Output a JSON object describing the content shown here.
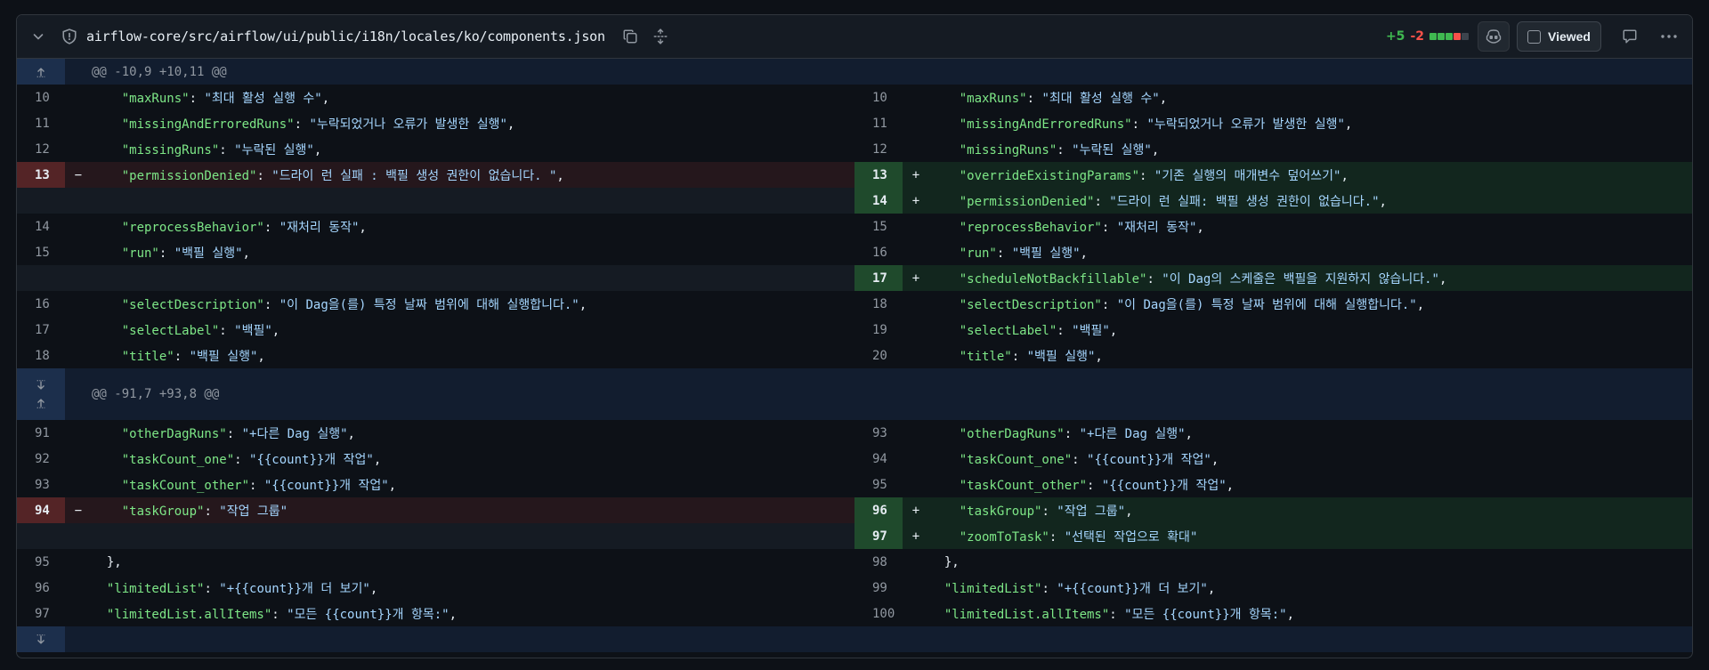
{
  "file": {
    "path": "airflow-core/src/airflow/ui/public/i18n/locales/ko/components.json",
    "additions": "+5",
    "deletions": "-2",
    "diffstat": [
      "add",
      "add",
      "add",
      "del",
      "neu"
    ],
    "viewed_label": "Viewed",
    "icons": {
      "collapse": "chevron-down-icon",
      "shield": "shield-icon",
      "copy": "copy-icon",
      "expand": "unfold-icon",
      "copilot": "copilot-icon",
      "comment": "comment-icon",
      "more": "kebab-icon"
    }
  },
  "hunks": [
    {
      "header": "@@ -10,9 +10,11 @@",
      "rows": [
        {
          "type": "ctx",
          "l": "10",
          "r": "10",
          "indent": "    ",
          "key": "\"maxRuns\"",
          "val": "\"최대 활성 실행 수\"",
          "tail": ","
        },
        {
          "type": "ctx",
          "l": "11",
          "r": "11",
          "indent": "    ",
          "key": "\"missingAndErroredRuns\"",
          "val": "\"누락되었거나 오류가 발생한 실행\"",
          "tail": ","
        },
        {
          "type": "ctx",
          "l": "12",
          "r": "12",
          "indent": "    ",
          "key": "\"missingRuns\"",
          "val": "\"누락된 실행\"",
          "tail": ","
        },
        {
          "type": "chg",
          "l": "13",
          "lkey": "\"permissionDenied\"",
          "lval": "\"드라이 런 실패 : 백필 생성 권한이 없습니다. \"",
          "ltail": ",",
          "r": "13",
          "rkey": "\"overrideExistingParams\"",
          "rval": "\"기존 실행의 매개변수 덮어쓰기\"",
          "rtail": ","
        },
        {
          "type": "add",
          "r": "14",
          "key": "\"permissionDenied\"",
          "val": "\"드라이 런 실패: 백필 생성 권한이 없습니다.\"",
          "tail": ","
        },
        {
          "type": "ctx",
          "l": "14",
          "r": "15",
          "indent": "    ",
          "key": "\"reprocessBehavior\"",
          "val": "\"재처리 동작\"",
          "tail": ","
        },
        {
          "type": "ctx",
          "l": "15",
          "r": "16",
          "indent": "    ",
          "key": "\"run\"",
          "val": "\"백필 실행\"",
          "tail": ","
        },
        {
          "type": "add",
          "r": "17",
          "key": "\"scheduleNotBackfillable\"",
          "val": "\"이 Dag의 스케줄은 백필을 지원하지 않습니다.\"",
          "tail": ","
        },
        {
          "type": "ctx",
          "l": "16",
          "r": "18",
          "indent": "    ",
          "key": "\"selectDescription\"",
          "val": "\"이 Dag을(를) 특정 날짜 범위에 대해 실행합니다.\"",
          "tail": ","
        },
        {
          "type": "ctx",
          "l": "17",
          "r": "19",
          "indent": "    ",
          "key": "\"selectLabel\"",
          "val": "\"백필\"",
          "tail": ","
        },
        {
          "type": "ctx",
          "l": "18",
          "r": "20",
          "indent": "    ",
          "key": "\"title\"",
          "val": "\"백필 실행\"",
          "tail": ","
        }
      ]
    },
    {
      "header": "@@ -91,7 +93,8 @@",
      "rows": [
        {
          "type": "ctx",
          "l": "91",
          "r": "93",
          "indent": "    ",
          "key": "\"otherDagRuns\"",
          "val": "\"+다른 Dag 실행\"",
          "tail": ","
        },
        {
          "type": "ctx",
          "l": "92",
          "r": "94",
          "indent": "    ",
          "key": "\"taskCount_one\"",
          "val": "\"{{count}}개 작업\"",
          "tail": ","
        },
        {
          "type": "ctx",
          "l": "93",
          "r": "95",
          "indent": "    ",
          "key": "\"taskCount_other\"",
          "val": "\"{{count}}개 작업\"",
          "tail": ","
        },
        {
          "type": "chg",
          "l": "94",
          "lkey": "\"taskGroup\"",
          "lval": "\"작업 그룹\"",
          "ltail": "",
          "r": "96",
          "rkey": "\"taskGroup\"",
          "rval": "\"작업 그룹\"",
          "rtail": ","
        },
        {
          "type": "add",
          "r": "97",
          "key": "\"zoomToTask\"",
          "val": "\"선택된 작업으로 확대\"",
          "tail": ""
        },
        {
          "type": "raw",
          "l": "95",
          "r": "98",
          "text": "  },"
        },
        {
          "type": "ctx",
          "l": "96",
          "r": "99",
          "indent": "  ",
          "key": "\"limitedList\"",
          "val": "\"+{{count}}개 더 보기\"",
          "tail": ","
        },
        {
          "type": "ctx",
          "l": "97",
          "r": "100",
          "indent": "  ",
          "key": "\"limitedList.allItems\"",
          "val": "\"모든 {{count}}개 항목:\"",
          "tail": ","
        }
      ]
    }
  ]
}
